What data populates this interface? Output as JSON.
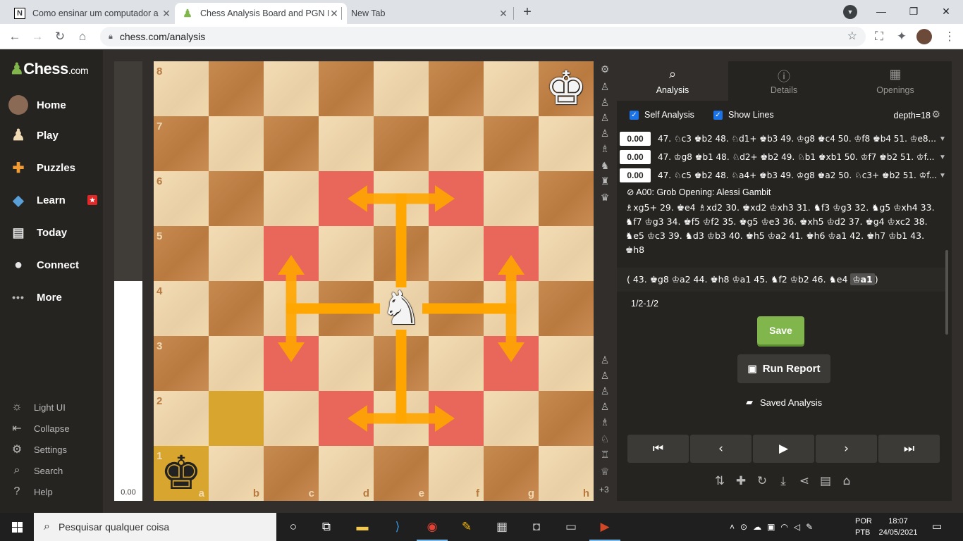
{
  "browser": {
    "tabs": [
      {
        "title": "Como ensinar um computador a",
        "favicon": "N",
        "active": false
      },
      {
        "title": "Chess Analysis Board and PGN Ed",
        "favicon": "pawn",
        "active": true
      },
      {
        "title": "New Tab",
        "favicon": "",
        "active": false
      }
    ],
    "url": "chess.com/analysis"
  },
  "sidebar": {
    "logo": "Chess",
    "logo_suffix": ".com",
    "items": [
      {
        "label": "Home",
        "icon": "avatar-icon"
      },
      {
        "label": "Play",
        "icon": "play-pawn-icon"
      },
      {
        "label": "Puzzles",
        "icon": "puzzle-icon"
      },
      {
        "label": "Learn",
        "icon": "learn-icon",
        "badge": "★"
      },
      {
        "label": "Today",
        "icon": "calendar-icon"
      },
      {
        "label": "Connect",
        "icon": "chat-icon"
      },
      {
        "label": "More",
        "icon": "more-icon"
      }
    ],
    "bottom": [
      {
        "label": "Light UI",
        "icon": "sun-icon"
      },
      {
        "label": "Collapse",
        "icon": "collapse-icon"
      },
      {
        "label": "Settings",
        "icon": "gear-icon"
      },
      {
        "label": "Search",
        "icon": "search-icon"
      },
      {
        "label": "Help",
        "icon": "help-icon"
      }
    ]
  },
  "eval": {
    "value": "0.00",
    "white_fraction": 0.5
  },
  "board": {
    "ranks": [
      "8",
      "7",
      "6",
      "5",
      "4",
      "3",
      "2",
      "1"
    ],
    "files": [
      "a",
      "b",
      "c",
      "d",
      "e",
      "f",
      "g",
      "h"
    ],
    "highlight_red": [
      "d6",
      "f6",
      "c5",
      "g5",
      "c3",
      "g3",
      "d2",
      "f2"
    ],
    "highlight_yellow": [
      "a1",
      "b2"
    ],
    "pieces": [
      {
        "square": "h8",
        "glyph": "♔",
        "name": "white-king"
      },
      {
        "square": "e4",
        "glyph": "♘",
        "name": "white-knight"
      },
      {
        "square": "a1",
        "glyph": "♚",
        "name": "black-king"
      }
    ],
    "arrow_color": "#ffa500"
  },
  "panel": {
    "tabs": [
      {
        "label": "Analysis",
        "icon": "⌕"
      },
      {
        "label": "Details",
        "icon": "ⓘ"
      },
      {
        "label": "Openings",
        "icon": "▦"
      }
    ],
    "self_analysis_label": "Self Analysis",
    "show_lines_label": "Show Lines",
    "depth": "depth=18",
    "lines": [
      {
        "score": "0.00",
        "moves": "47. ♘c3 ♚b2 48. ♘d1+ ♚b3 49. ♔g8 ♚c4 50. ♔f8 ♚b4 51. ♔e8..."
      },
      {
        "score": "0.00",
        "moves": "47. ♔g8 ♚b1 48. ♘d2+ ♚b2 49. ♘b1 ♚xb1 50. ♔f7 ♚b2 51. ♔f..."
      },
      {
        "score": "0.00",
        "moves": "47. ♘c5 ♚b2 48. ♘a4+ ♚b3 49. ♔g8 ♚a2 50. ♘c3+ ♚b2 51. ♔f..."
      }
    ],
    "opening": "A00: Grob Opening: Alessi Gambit",
    "movelist": "♗xg5+ 29. ♚e4 ♗xd2 30. ♚xd2 ♔xh3 31. ♞f3 ♔g3 32. ♞g5 ♔xh4 33. ♞f7 ♔g3 34. ♚f5 ♔f2 35. ♚g5 ♔e3 36. ♚xh5 ♔d2 37. ♚g4 ♔xc2 38. ♞e5 ♔c3 39. ♞d3 ♔b3 40. ♚h5 ♔a2 41. ♚h6 ♔a1 42. ♚h7 ♔b1 43. ♚h8",
    "variation_prefix": "( 43. ♚g8 ♔a2 44. ♚h8 ♔a1 45. ♞f2 ♔b2 46. ♞e4 ",
    "variation_current": "♔a1",
    "variation_suffix": ")",
    "result": "1/2-1/2",
    "save_label": "Save",
    "run_report_label": "Run Report",
    "saved_analysis_label": "Saved Analysis",
    "controls": [
      "⏮",
      "‹",
      "▶",
      "›",
      "⏭"
    ]
  },
  "taskbar": {
    "search_placeholder": "Pesquisar qualquer coisa",
    "lang_1": "POR",
    "lang_2": "PTB",
    "time": "18:07",
    "date": "24/05/2021"
  }
}
